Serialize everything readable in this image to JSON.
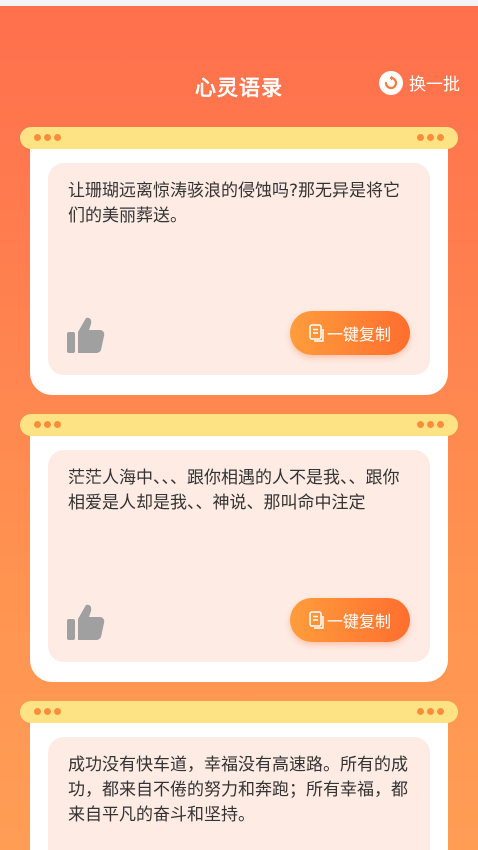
{
  "header": {
    "title": "心灵语录",
    "refresh_label": "换一批"
  },
  "quotes": [
    {
      "text": "让珊瑚远离惊涛骇浪的侵蚀吗?那无异是将它们的美丽葬送。",
      "copy_label": "一键复制"
    },
    {
      "text": "茫茫人海中、、、跟你相遇的人不是我、、跟你相爱是人却是我、、神说、那叫命中注定",
      "copy_label": "一键复制"
    },
    {
      "text": "成功没有快车道，幸福没有高速路。所有的成功，都来自不倦的努力和奔跑；所有幸福，都来自平凡的奋斗和坚持。"
    }
  ],
  "icons": {
    "refresh": "refresh-icon",
    "like": "thumbs-up-icon",
    "copy": "copy-icon"
  },
  "colors": {
    "accent": "#ff7a3a",
    "bar": "#fde383",
    "dot": "#ff8c3a",
    "quote_bg": "#fdebe4"
  }
}
